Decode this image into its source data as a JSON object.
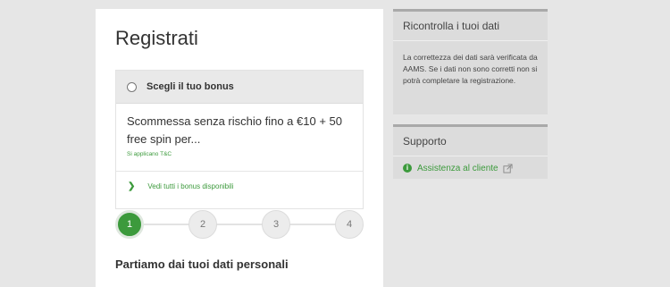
{
  "main": {
    "title": "Registrati",
    "bonus": {
      "header_label": "Scegli il tuo bonus",
      "offer_text": "Scommessa senza rischio fino a €10 + 50 free spin per...",
      "terms_text": "Si applicano T&C",
      "view_all_label": "Vedi tutti i bonus disponibili"
    },
    "steps": [
      "1",
      "2",
      "3",
      "4"
    ],
    "active_step": 1,
    "step_heading": "Partiamo dai tuoi dati personali"
  },
  "sidebar": {
    "review": {
      "title": "Ricontrolla i tuoi dati",
      "text": "La correttezza dei dati sarà verificata da AAMS. Se i dati non sono corretti non si potrà completare la registrazione."
    },
    "support": {
      "title": "Supporto",
      "link_label": "Assistenza al cliente"
    }
  },
  "colors": {
    "accent": "#3c9a3c",
    "background": "#e6e6e6",
    "card": "#ffffff",
    "sidebar_card": "#dcdcdc"
  },
  "icons": [
    "radio-icon",
    "chevron-right-icon",
    "info-icon",
    "external-link-icon"
  ]
}
